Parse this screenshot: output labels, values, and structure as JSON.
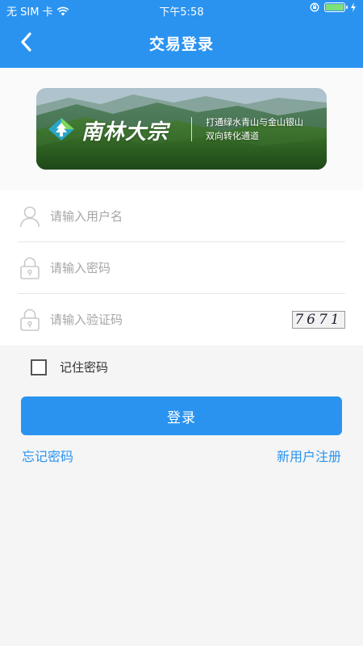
{
  "status_bar": {
    "carrier": "无 SIM 卡",
    "time": "下午5:58",
    "battery_color": "#7ee07a"
  },
  "header": {
    "title": "交易登录",
    "back_icon": "chevron-left-icon",
    "bg_color": "#2a93f0"
  },
  "banner": {
    "brand": "南林大宗",
    "slogan_line1": "打通绿水青山与金山银山",
    "slogan_line2": "双向转化通道"
  },
  "form": {
    "username_placeholder": "请输入用户名",
    "password_placeholder": "请输入密码",
    "captcha_placeholder": "请输入验证码",
    "captcha_text": "7671"
  },
  "remember": {
    "label": "记住密码",
    "checked": false
  },
  "login_button": "登录",
  "links": {
    "forgot": "忘记密码",
    "register": "新用户注册"
  },
  "accent_color": "#2a93f0"
}
